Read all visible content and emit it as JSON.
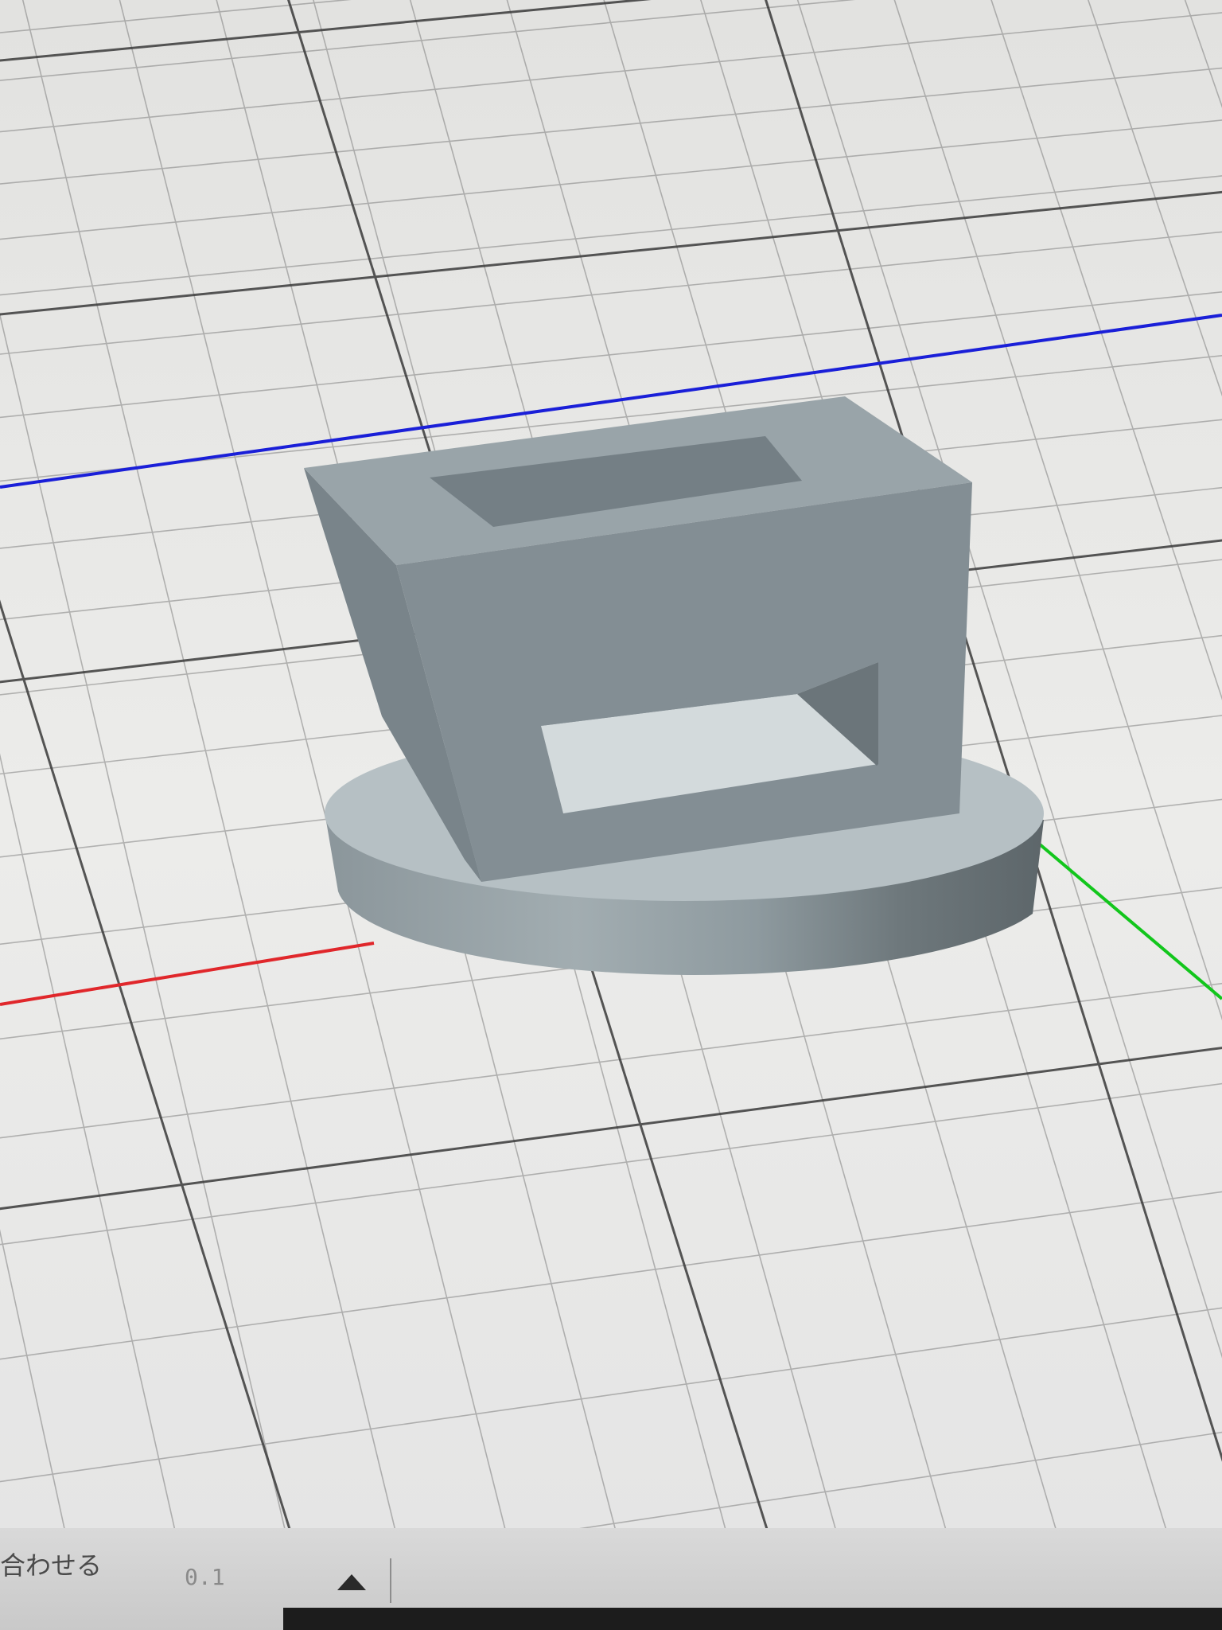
{
  "toolbar": {
    "snap_label": "合わせる",
    "snap_value": "0.1",
    "step_up_icon": "triangle-up-icon"
  },
  "viewport": {
    "axis_colors": {
      "x": "#e0272b",
      "y": "#12c61c",
      "z": "#1a1fd8"
    },
    "model_color": "#8f9ba0",
    "grid_color": "#3a3a3a"
  }
}
